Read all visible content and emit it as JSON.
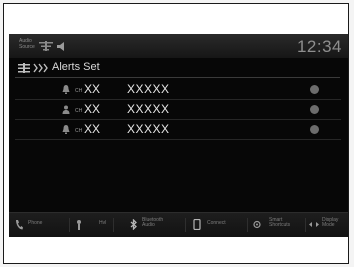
{
  "status": {
    "audio_source": "Audio Source",
    "clock": "12:34"
  },
  "title": "Alerts Set",
  "rows": [
    {
      "ch": "CH",
      "num": "XX",
      "name": "XXXXX"
    },
    {
      "ch": "CH",
      "num": "XX",
      "name": "XXXXX"
    },
    {
      "ch": "CH",
      "num": "XX",
      "name": "XXXXX"
    }
  ],
  "bottom": {
    "phone": "Phone",
    "hvac": "Hvl",
    "bt_audio": "Bluetooth Audio",
    "connect": "Connect",
    "smart_shortcuts": "Smart Shortcuts",
    "display_mode": "Display Mode"
  },
  "colors": {
    "screen_bg": "#070707",
    "text": "#e6e6e6",
    "muted": "#8e8e8e"
  }
}
